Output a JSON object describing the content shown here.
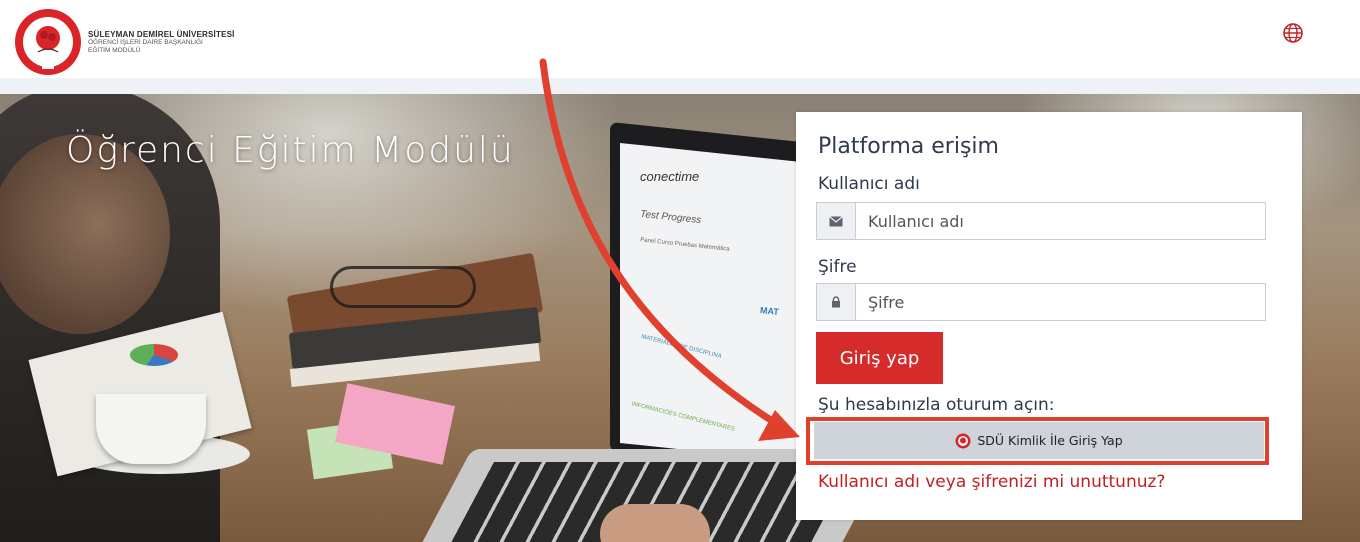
{
  "header": {
    "university_name": "SÜLEYMAN DEMİREL ÜNİVERSİTESİ",
    "department_line": "ÖĞRENCİ İŞLERİ DAİRE BAŞKANLIĞI",
    "module_line": "EĞİTİM MODÜLÜ",
    "language_icon": "globe-icon"
  },
  "hero": {
    "title": "Öğrenci Eğitim Modülü",
    "laptop_brand": "conectime",
    "laptop_heading": "Test Progress",
    "laptop_tabs": "Panel   Curso   Pruebas   Matemática",
    "laptop_section": "MAT",
    "laptop_section1": "MATERIALES DE DISCIPLINA",
    "laptop_section2": "INFORMACIÓES COMPLEMENTARES"
  },
  "login": {
    "title": "Platforma erişim",
    "username_label": "Kullanıcı adı",
    "username_placeholder": "Kullanıcı adı",
    "username_icon": "envelope-icon",
    "password_label": "Şifre",
    "password_placeholder": "Şifre",
    "password_icon": "lock-icon",
    "submit_label": "Giriş yap",
    "alt_login_label": "Şu hesabınızla oturum açın:",
    "sso_button_label": "SDÜ Kimlik İle Giriş Yap",
    "forgot_link": "Kullanıcı adı veya şifrenizi mi unuttunuz?"
  },
  "colors": {
    "brand_red": "#d52b2b",
    "highlight_red": "#e0412e",
    "link_red": "#c11f24",
    "sso_button_bg": "#ced4da"
  }
}
